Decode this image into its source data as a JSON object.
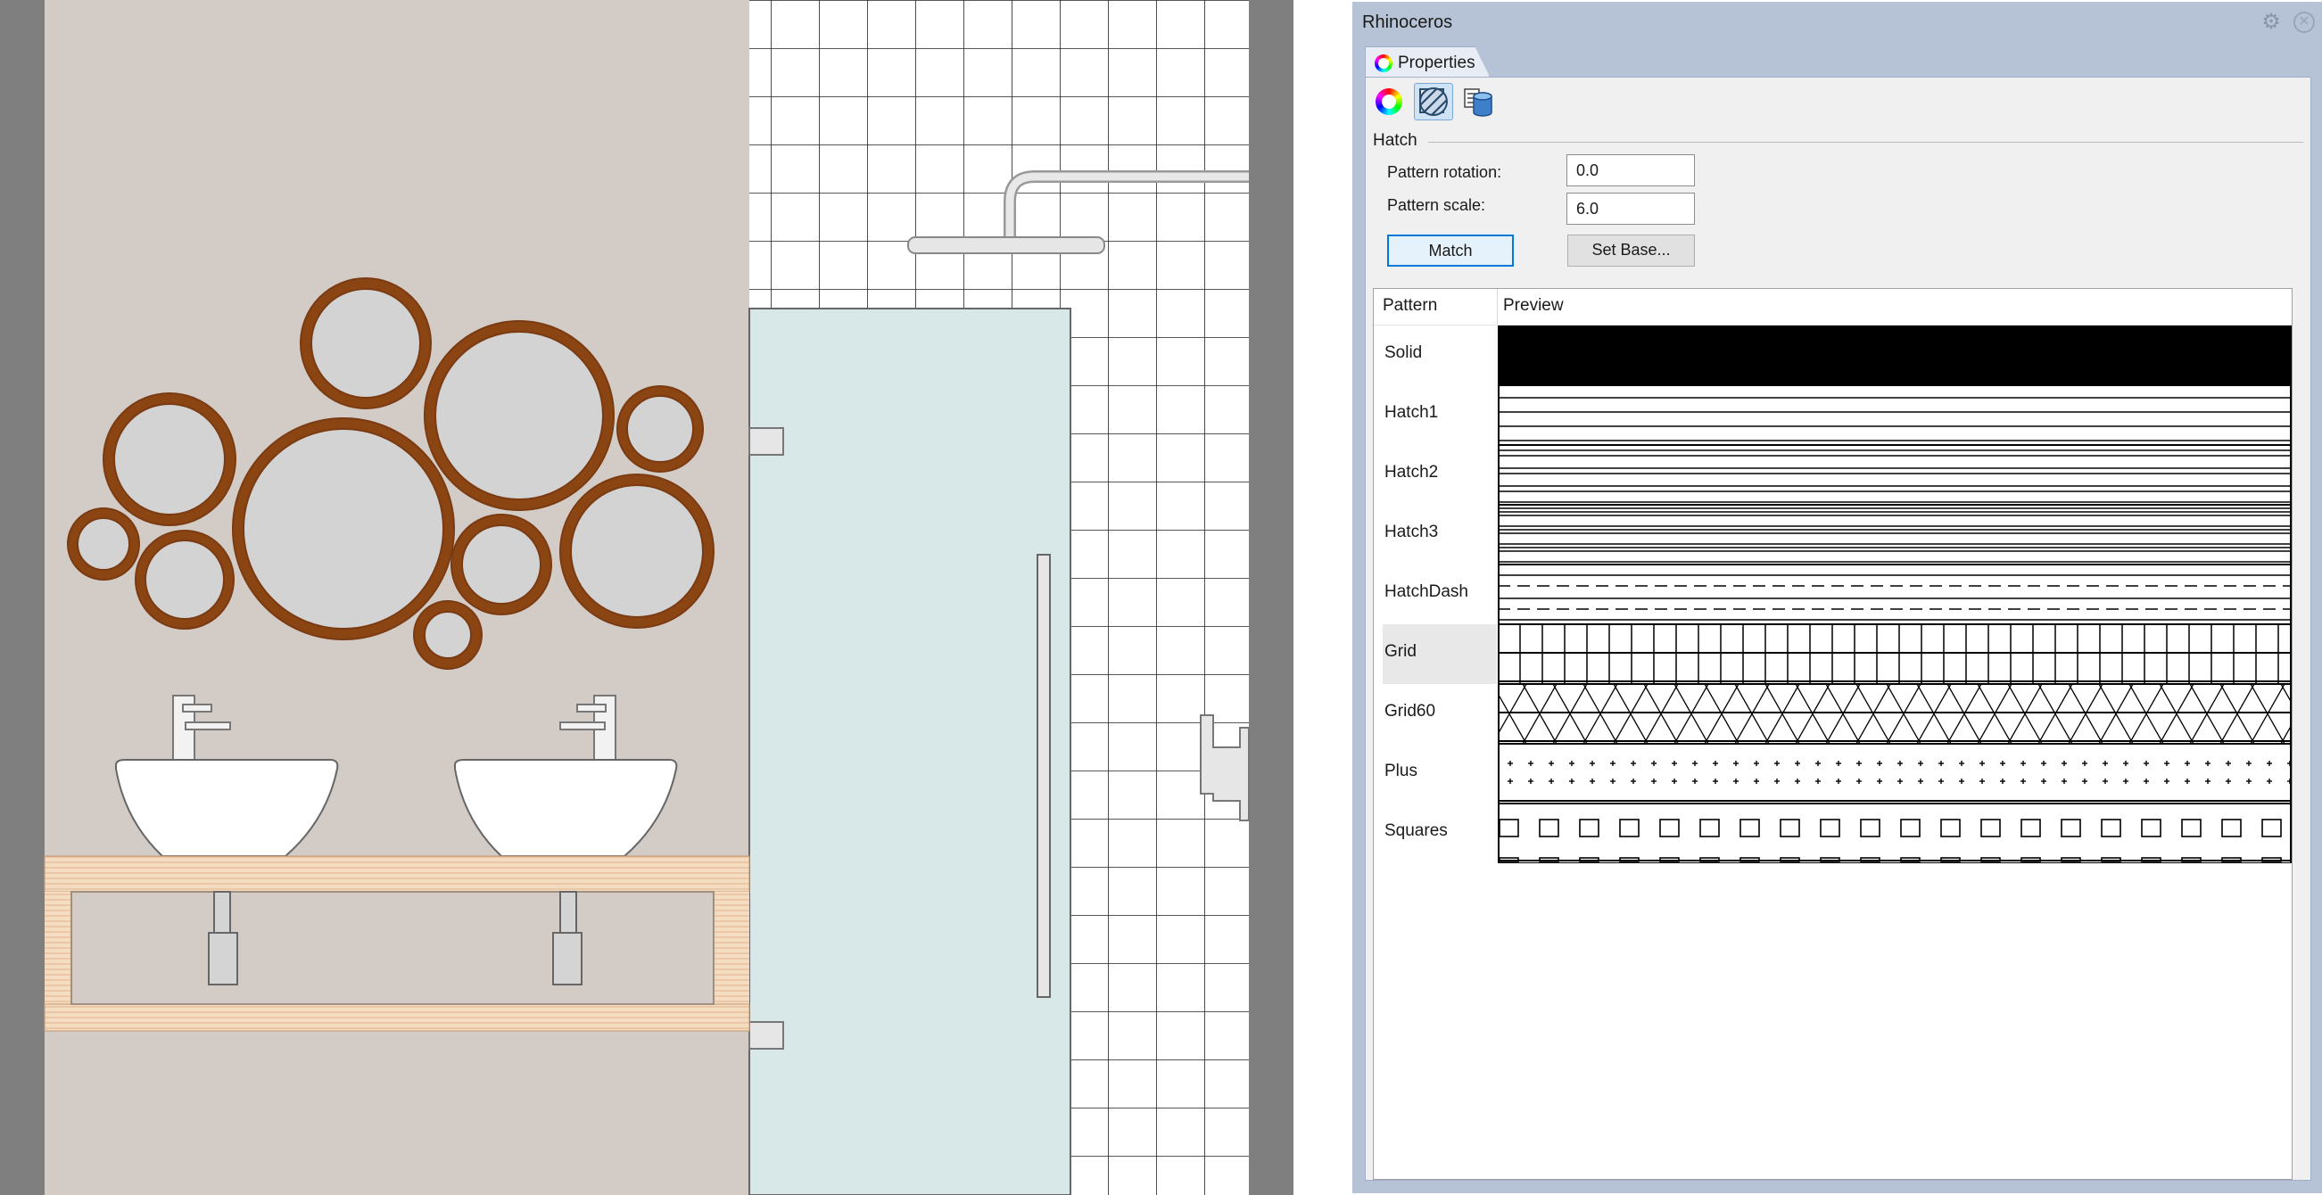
{
  "panel": {
    "title": "Rhinoceros",
    "gear_icon": "gear-icon",
    "close_icon": "close-icon",
    "tab_label": "Properties",
    "page_buttons": [
      {
        "name": "object-properties",
        "icon": "color-wheel-icon",
        "selected": false
      },
      {
        "name": "hatch-properties",
        "icon": "hatch-icon",
        "selected": true
      },
      {
        "name": "layer-properties",
        "icon": "layers-icon",
        "selected": false
      }
    ],
    "section": "Hatch",
    "rotation_label": "Pattern rotation:",
    "rotation_value": "0.0",
    "scale_label": "Pattern scale:",
    "scale_value": "6.0",
    "match_label": "Match",
    "setbase_label": "Set Base...",
    "columns": {
      "pattern": "Pattern",
      "preview": "Preview"
    },
    "patterns": [
      {
        "name": "Solid",
        "kind": "solid"
      },
      {
        "name": "Hatch1",
        "kind": "hatch1"
      },
      {
        "name": "Hatch2",
        "kind": "hatch2"
      },
      {
        "name": "Hatch3",
        "kind": "hatch3"
      },
      {
        "name": "HatchDash",
        "kind": "dash"
      },
      {
        "name": "Grid",
        "kind": "grid"
      },
      {
        "name": "Grid60",
        "kind": "grid60"
      },
      {
        "name": "Plus",
        "kind": "plus"
      },
      {
        "name": "Squares",
        "kind": "squares"
      }
    ],
    "selected_pattern": "Grid"
  },
  "colors": {
    "wall": "#d3cbc5",
    "frame": "#7f7f7f",
    "mirror_frame": "#8b4513",
    "mirror_glass": "#d3d3d3",
    "glass_door": "#d8e8e8",
    "counter": "#f2d9b8",
    "panel_bg": "#b6c3d6",
    "accent": "#0078d7"
  }
}
